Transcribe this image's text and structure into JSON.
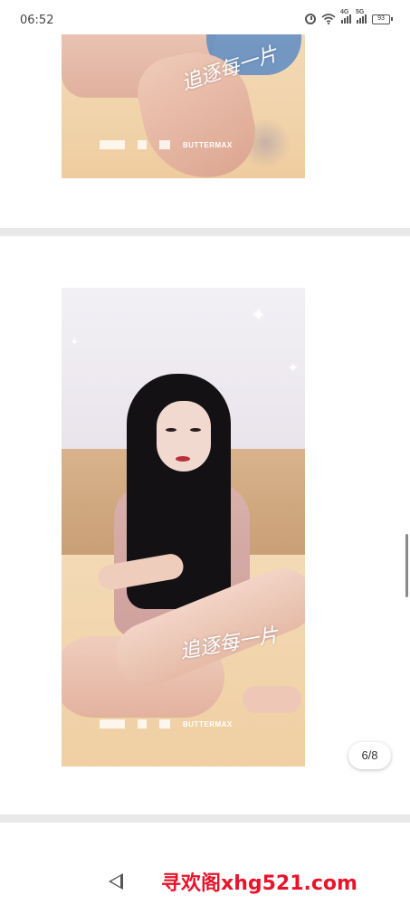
{
  "status_bar": {
    "time": "06:52",
    "signal_1_label": "4G",
    "signal_2_label": "5G",
    "battery": "93"
  },
  "post": {
    "image_top": {
      "overlay_script": "追逐每一片",
      "brand": "BUTTERMAX"
    },
    "image_main": {
      "overlay_script": "追逐每一片",
      "brand": "BUTTERMAX"
    }
  },
  "viewer": {
    "page_indicator": "6/8"
  },
  "watermark": {
    "text": "寻欢阁xhg521.com",
    "color": "#e8142b"
  },
  "icons": [
    "alarm-icon",
    "wifi-icon",
    "signal-icon",
    "battery-icon",
    "back-icon"
  ]
}
